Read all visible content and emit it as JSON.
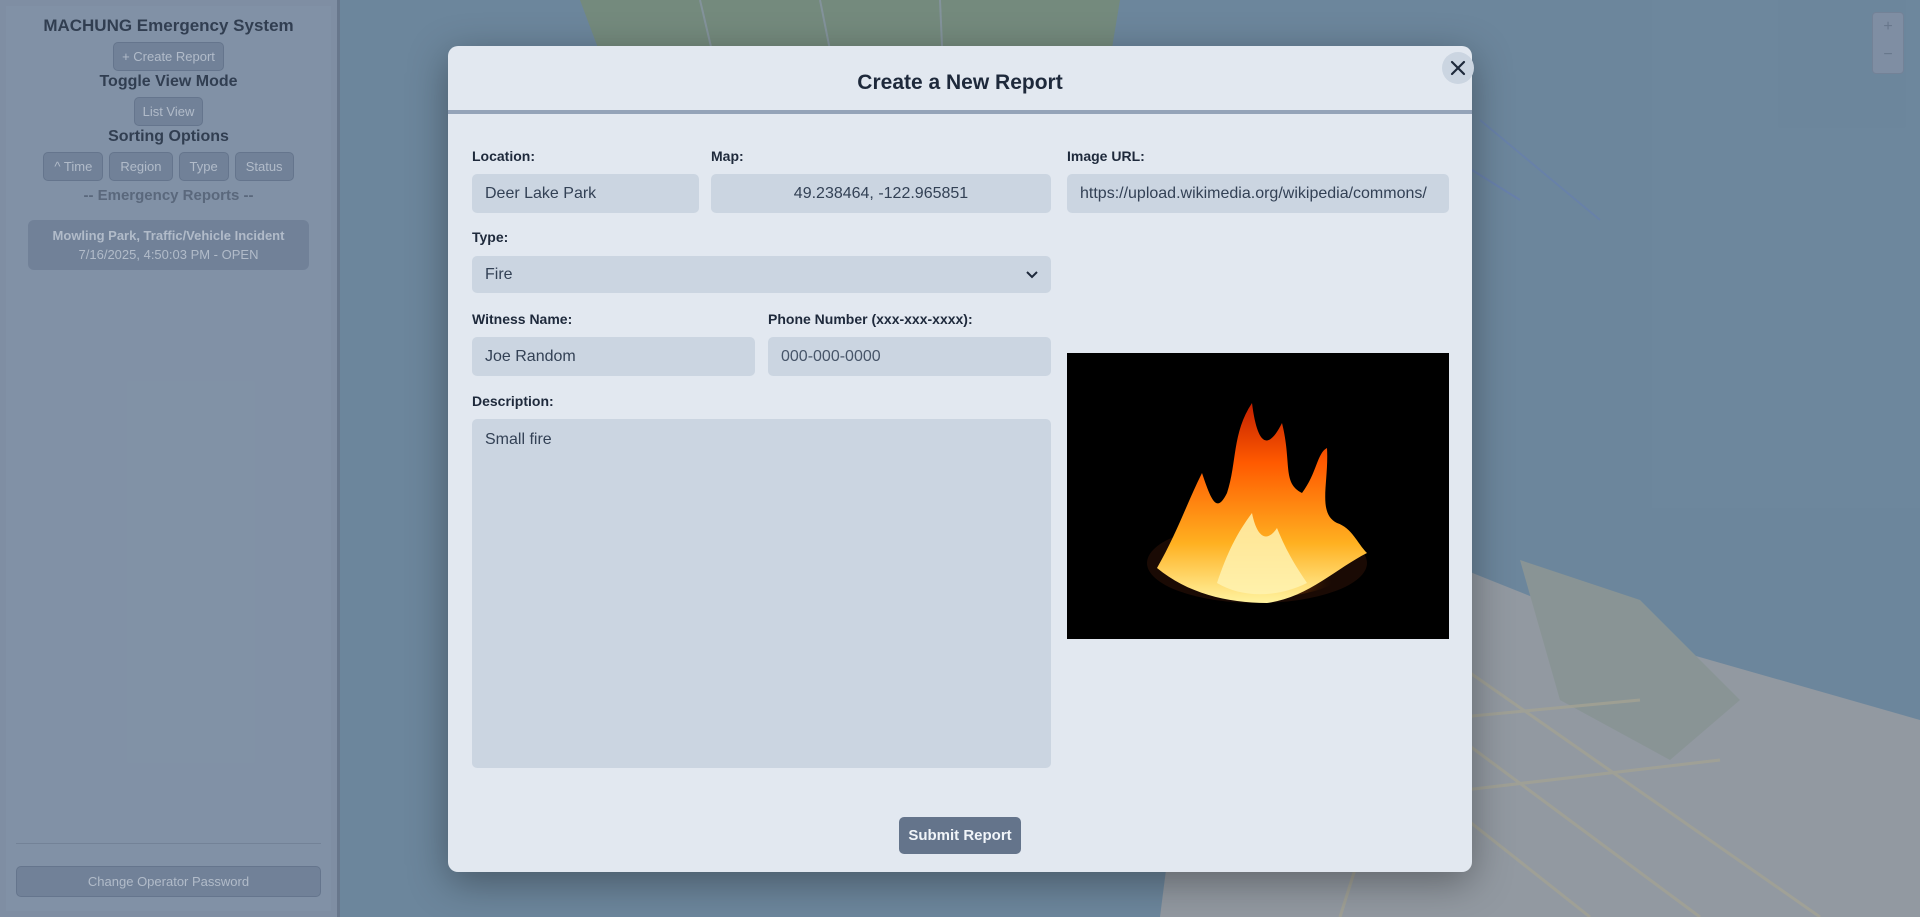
{
  "sidebar": {
    "title": "MACHUNG Emergency System",
    "new_report_button": "+ Create Report",
    "toggle_label": "Toggle View Mode",
    "view_button": "List View",
    "sorting_label": "Sorting Options",
    "sort_buttons": [
      "^ Time",
      "Region",
      "Type",
      "Status"
    ],
    "reports_heading": "-- Emergency Reports --",
    "report_card": {
      "title": "Mowling Park, Traffic/Vehicle Incident",
      "subtitle": "7/16/2025, 4:50:03 PM - OPEN"
    },
    "footer_button": "Change Operator Password"
  },
  "modal": {
    "title": "Create a New Report",
    "location": {
      "label": "Location:",
      "value": "Deer Lake Park"
    },
    "map": {
      "label": "Map:",
      "value": "49.238464, -122.965851"
    },
    "image_url": {
      "label": "Image URL:",
      "value": "https://upload.wikimedia.org/wikipedia/commons/"
    },
    "type": {
      "label": "Type:",
      "value": "Fire"
    },
    "witness": {
      "label": "Witness Name:",
      "value": "Joe Random"
    },
    "phone": {
      "label": "Phone Number (xxx-xxx-xxxx):",
      "placeholder": "000-000-0000"
    },
    "description": {
      "label": "Description:",
      "value": "Small fire"
    },
    "submit_label": "Submit Report"
  },
  "map_controls": {
    "zoom_in": "+",
    "zoom_out": "−"
  },
  "icons": [
    "close-icon",
    "chevron-down-icon",
    "fire-image"
  ]
}
